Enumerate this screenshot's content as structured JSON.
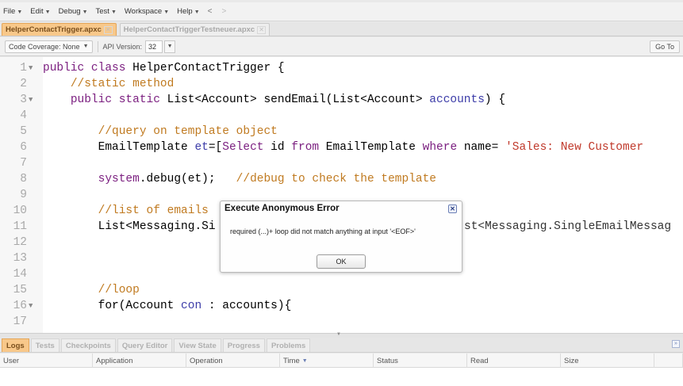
{
  "menubar": {
    "items": [
      {
        "label": "File",
        "has_caret": true
      },
      {
        "label": "Edit",
        "has_caret": true
      },
      {
        "label": "Debug",
        "has_caret": true
      },
      {
        "label": "Test",
        "has_caret": true
      },
      {
        "label": "Workspace",
        "has_caret": true
      },
      {
        "label": "Help",
        "has_caret": true
      }
    ],
    "back_glyph": "<",
    "forward_glyph": ">"
  },
  "file_tabs": [
    {
      "label": "HelperContactTrigger.apxc",
      "active": true
    },
    {
      "label": "HelperContactTriggerTestneuer.apxc",
      "active": false
    }
  ],
  "toolbar": {
    "code_coverage": "Code Coverage: None",
    "api_version_label": "API Version:",
    "api_version_value": "32",
    "goto_label": "Go To"
  },
  "editor": {
    "lines": [
      {
        "no": "1",
        "fold": true
      },
      {
        "no": "2",
        "fold": false
      },
      {
        "no": "3",
        "fold": true
      },
      {
        "no": "4",
        "fold": false
      },
      {
        "no": "5",
        "fold": false
      },
      {
        "no": "6",
        "fold": false
      },
      {
        "no": "7",
        "fold": false
      },
      {
        "no": "8",
        "fold": false
      },
      {
        "no": "9",
        "fold": false
      },
      {
        "no": "10",
        "fold": false
      },
      {
        "no": "11",
        "fold": false
      },
      {
        "no": "12",
        "fold": false
      },
      {
        "no": "13",
        "fold": false
      },
      {
        "no": "14",
        "fold": false
      },
      {
        "no": "15",
        "fold": false
      },
      {
        "no": "16",
        "fold": true
      },
      {
        "no": "17",
        "fold": false
      }
    ],
    "code": {
      "l1": {
        "kw": "public class",
        "rest": " HelperContactTrigger {"
      },
      "l2": {
        "comment": "//static method"
      },
      "l3": {
        "kw": "public static",
        "mid": " List<Account> sendEmail(List<Account> ",
        "name": "accounts",
        "rest": ") {"
      },
      "l5": {
        "comment": "//query on template object"
      },
      "l6": {
        "pre": "EmailTemplate ",
        "name": "et",
        "eq": "=[",
        "kw": "Select",
        "mid": " id ",
        "kw2": "from",
        "mid2": " EmailTemplate ",
        "kw3": "where",
        "mid3": " name= ",
        "str": "'Sales: New Customer"
      },
      "l8": {
        "kw": "system",
        "rest": ".debug(et);   ",
        "comment": "//debug to check the template"
      },
      "l10": {
        "comment": "//list of emails"
      },
      "l11": {
        "pre": "List<Messaging.Si",
        "rest": "st<Messaging.SingleEmailMessag"
      },
      "l15": {
        "comment": "//loop"
      },
      "l16": {
        "pre": "for(Account ",
        "name": "con",
        "rest": " : accounts){"
      }
    }
  },
  "dialog": {
    "title": "Execute Anonymous Error",
    "message": "required (...)+ loop did not match anything at input '<EOF>'",
    "ok_label": "OK",
    "close_glyph": "✕"
  },
  "bottom_tabs": [
    {
      "label": "Logs",
      "active": true
    },
    {
      "label": "Tests",
      "active": false
    },
    {
      "label": "Checkpoints",
      "active": false
    },
    {
      "label": "Query Editor",
      "active": false
    },
    {
      "label": "View State",
      "active": false
    },
    {
      "label": "Progress",
      "active": false
    },
    {
      "label": "Problems",
      "active": false
    }
  ],
  "logs_table": {
    "columns": [
      {
        "label": "User"
      },
      {
        "label": "Application"
      },
      {
        "label": "Operation"
      },
      {
        "label": "Time",
        "sorted": true
      },
      {
        "label": "Status"
      },
      {
        "label": "Read"
      },
      {
        "label": "Size"
      },
      {
        "label": ""
      }
    ],
    "rows": []
  },
  "colors": {
    "active_tab": "#f8c88a",
    "keyword": "#7a1d7f",
    "comment": "#c07a20",
    "string": "#c0392b",
    "identifier": "#3c3ca8"
  },
  "icons": {
    "menu_caret": "chevron-down-icon",
    "tab_close": "close-icon",
    "fold_marker": "fold-arrow-icon",
    "dialog_close": "close-icon",
    "panel_collapse": "collapse-icon",
    "sort": "sort-down-icon"
  }
}
